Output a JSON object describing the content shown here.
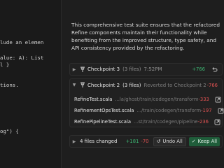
{
  "editor": {
    "lines": [
      "lude an elemen",
      "alue: A): List",
      "l }",
      "tions.",
      "og\") {"
    ]
  },
  "chat": {
    "summary": "This comprehensive test suite ensures that the refactored Refine components maintain their functionality while benefiting from the improved structure, type safety, and API consistency provided by the refactoring.",
    "checkpoint3": {
      "title": "Checkpoint 3",
      "files": "(3 files)",
      "time": "7:52PM",
      "added": "+766",
      "restore_icon": "undo-icon"
    },
    "checkpoint2": {
      "title": "Checkpoint 2",
      "files": "(3 files)",
      "reverted": "Reverted to Checkpoint 2",
      "removed": "-766",
      "files_list": [
        {
          "name": "RefineTest.scala",
          "path": "...la/ghost/train/codegen/transform",
          "removed": "-333"
        },
        {
          "name": "RefinementOpsTest.scala",
          "path": ".../train/codegen/transform",
          "removed": "-197"
        },
        {
          "name": "RefinePipelineTest.scala",
          "path": "...st/train/codegen/pipeline",
          "removed": "-236"
        }
      ]
    },
    "bottom": {
      "files_changed": "4 files changed",
      "added": "+181",
      "removed": "-70",
      "undo_label": "Undo All",
      "keep_label": "Keep All"
    }
  },
  "colors": {
    "added": "#3cb371",
    "removed": "#e05252",
    "keep_button": "#1f5d3a"
  }
}
